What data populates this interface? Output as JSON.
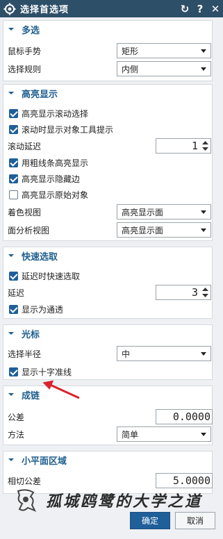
{
  "window": {
    "title": "选择首选项"
  },
  "sections": {
    "multi": {
      "title": "多选",
      "mouse_gesture": {
        "label": "鼠标手势",
        "value": "矩形"
      },
      "select_rule": {
        "label": "选择规则",
        "value": "内侧"
      }
    },
    "highlight": {
      "title": "高亮显示",
      "cb_scroll_select": {
        "label": "高亮显示滚动选择",
        "checked": true
      },
      "cb_tooltip": {
        "label": "滚动时显示对象工具提示",
        "checked": true
      },
      "scroll_delay": {
        "label": "滚动延迟",
        "value": "1"
      },
      "cb_thick": {
        "label": "用粗线条高亮显示",
        "checked": true
      },
      "cb_hidden_edges": {
        "label": "高亮显示隐藏边",
        "checked": true
      },
      "cb_original": {
        "label": "高亮显示原始对象",
        "checked": false
      },
      "shaded_view": {
        "label": "着色视图",
        "value": "高亮显示面"
      },
      "face_analysis": {
        "label": "面分析视图",
        "value": "高亮显示面"
      }
    },
    "quick": {
      "title": "快速选取",
      "cb_delay_quick": {
        "label": "延迟时快速选取",
        "checked": true
      },
      "delay": {
        "label": "延迟",
        "value": "3"
      },
      "cb_show_pass": {
        "label": "显示为通透",
        "checked": true
      }
    },
    "cursor": {
      "title": "光标",
      "radius": {
        "label": "选择半径",
        "value": "中"
      },
      "cb_crosshair": {
        "label": "显示十字准线",
        "checked": true
      }
    },
    "chain": {
      "title": "成链",
      "tolerance": {
        "label": "公差",
        "value": "0.0000"
      },
      "method": {
        "label": "方法",
        "value": "简单"
      }
    },
    "small_face": {
      "title": "小平面区域",
      "chord_tol": {
        "label": "相切公差",
        "value": "5.0000"
      }
    }
  },
  "buttons": {
    "ok": "确定",
    "cancel": "取消"
  },
  "watermark": "孤城鸥鹭的大学之道",
  "colors": {
    "titlebar": "#2d4f68",
    "accent": "#1f5f9a",
    "section": "#1f5f8f",
    "arrow": "#d9232d"
  }
}
